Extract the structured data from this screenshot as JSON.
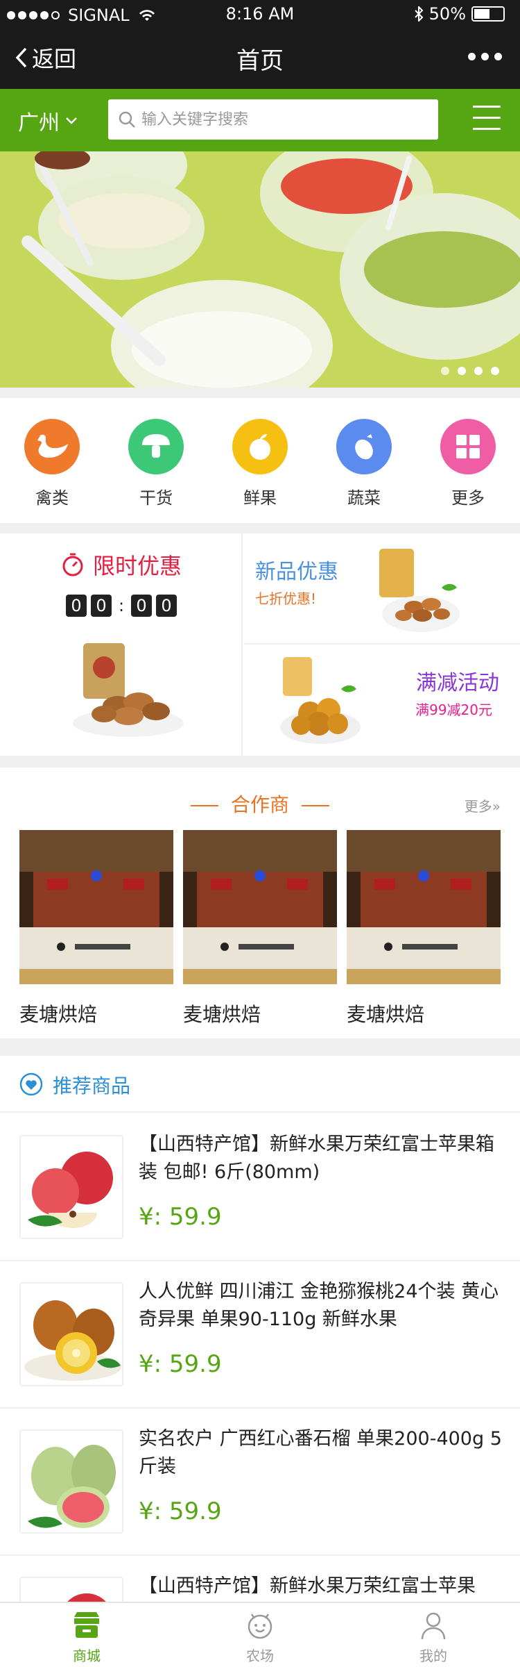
{
  "status_bar": {
    "carrier": "SIGNAL",
    "time": "8:16 AM",
    "battery": "50%",
    "battery_level": 0.5
  },
  "nav": {
    "back_label": "返回",
    "title": "首页"
  },
  "search": {
    "city": "广州",
    "placeholder": "输入关键字搜索"
  },
  "banner": {
    "slide_count": 4,
    "active_index": 3
  },
  "categories": [
    {
      "label": "禽类",
      "color": "#f07a2c",
      "icon": "goose-icon"
    },
    {
      "label": "干货",
      "color": "#3cc877",
      "icon": "mushroom-icon"
    },
    {
      "label": "鲜果",
      "color": "#f6c012",
      "icon": "apple-icon"
    },
    {
      "label": "蔬菜",
      "color": "#5b8bef",
      "icon": "eggplant-icon"
    },
    {
      "label": "更多",
      "color": "#ef5da5",
      "icon": "grid-icon"
    }
  ],
  "promo": {
    "flash_title": "限时优惠",
    "timer": [
      "0",
      "0",
      ":",
      "0",
      "0"
    ],
    "new_title": "新品优惠",
    "new_sub": "七折优惠!",
    "discount_title": "满减活动",
    "discount_sub": "满99减20元"
  },
  "partners": {
    "title": "合作商",
    "more": "更多»",
    "items": [
      {
        "name": "麦塘烘焙"
      },
      {
        "name": "麦塘烘焙"
      },
      {
        "name": "麦塘烘焙"
      }
    ]
  },
  "recommended": {
    "title": "推荐商品",
    "items": [
      {
        "title": "【山西特产馆】新鲜水果万荣红富士苹果箱装 包邮! 6斤(80mm)",
        "price": "¥: 59.9"
      },
      {
        "title": "人人优鲜 四川浦江 金艳猕猴桃24个装 黄心奇异果 单果90-110g 新鲜水果",
        "price": "¥: 59.9"
      },
      {
        "title": "实名农户 广西红心番石榴 单果200-400g 5斤装",
        "price": "¥: 59.9"
      },
      {
        "title": "【山西特产馆】新鲜水果万荣红富士苹果",
        "price": ""
      }
    ]
  },
  "tabbar": {
    "tabs": [
      {
        "label": "商城"
      },
      {
        "label": "农场"
      },
      {
        "label": "我的"
      }
    ],
    "active": 0
  },
  "colors": {
    "brand_green": "#56a513",
    "flash_red": "#e61e3f",
    "partner_orange": "#e87324",
    "rec_blue": "#2a8fd4"
  }
}
